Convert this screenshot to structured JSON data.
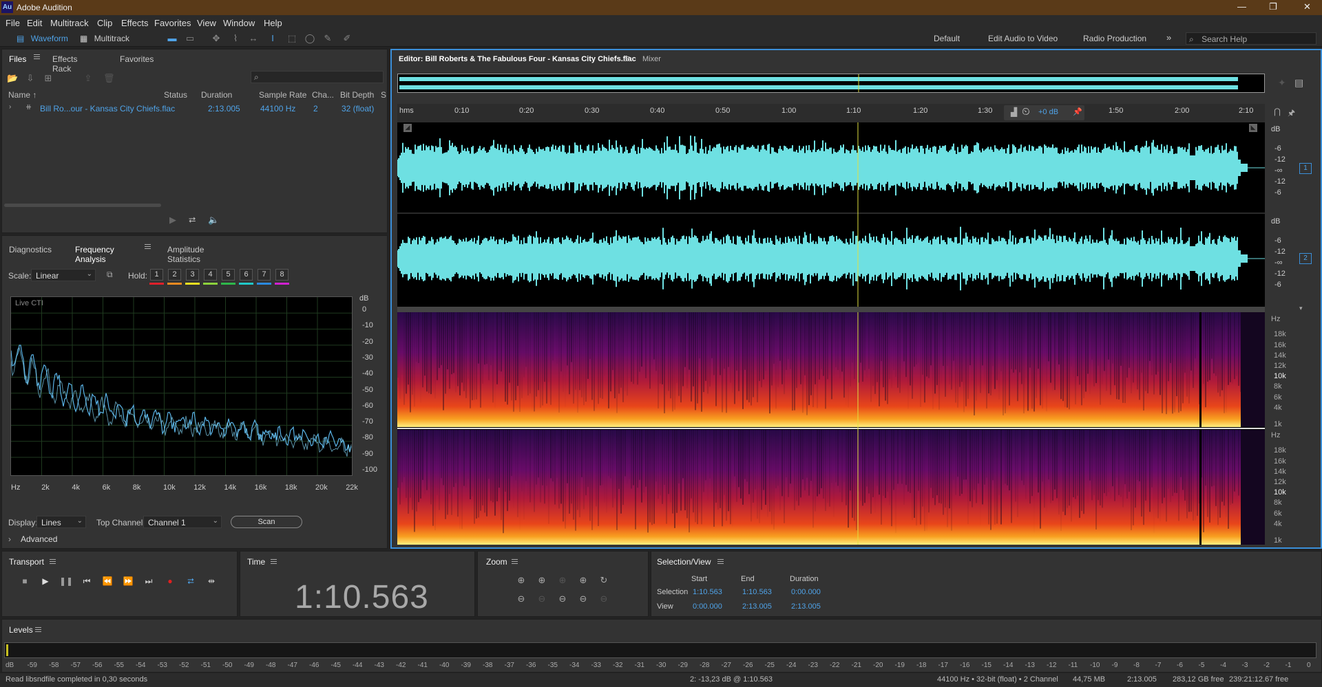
{
  "app": {
    "logo": "Au",
    "title": "Adobe Audition"
  },
  "menu": [
    "File",
    "Edit",
    "Multitrack",
    "Clip",
    "Effects",
    "Favorites",
    "View",
    "Window",
    "Help"
  ],
  "toolbar": {
    "waveform_label": "Waveform",
    "multitrack_label": "Multitrack",
    "workspaces": [
      "Default",
      "Edit Audio to Video",
      "Radio Production"
    ],
    "more": "»",
    "search_placeholder": "Search Help"
  },
  "files_panel": {
    "tabs": [
      "Files",
      "Effects Rack",
      "Favorites"
    ],
    "search_icon": "⌕",
    "columns": [
      "Name ↑",
      "Status",
      "Duration",
      "Sample Rate",
      "Cha...",
      "Bit Depth",
      "S"
    ],
    "file": {
      "name": "Bill Ro...our - Kansas City Chiefs.flac",
      "status": "",
      "duration": "2:13.005",
      "sample_rate": "44100 Hz",
      "channels": "2",
      "bit_depth": "32 (float)"
    }
  },
  "analysis_panel": {
    "tabs": [
      "Diagnostics",
      "Frequency Analysis",
      "Amplitude Statistics"
    ],
    "scale_label": "Scale:",
    "scale_value": "Linear",
    "hold_label": "Hold:",
    "hold_buttons": [
      "1",
      "2",
      "3",
      "4",
      "5",
      "6",
      "7",
      "8"
    ],
    "hold_colors": [
      "#e0202a",
      "#f08a20",
      "#f0e020",
      "#8cd23c",
      "#2eb84a",
      "#20c8c8",
      "#2a8ae0",
      "#d020d0"
    ],
    "graph_label": "Live CTI",
    "db_unit": "dB",
    "db_ticks": [
      "0",
      "-10",
      "-20",
      "-30",
      "-40",
      "-50",
      "-60",
      "-70",
      "-80",
      "-90",
      "-100"
    ],
    "hz_ticks": [
      "Hz",
      "2k",
      "4k",
      "6k",
      "8k",
      "10k",
      "12k",
      "14k",
      "16k",
      "18k",
      "20k",
      "22k"
    ],
    "display_label": "Display:",
    "display_value": "Lines",
    "top_channel_label": "Top Channel:",
    "top_channel_value": "Channel 1",
    "scan_label": "Scan",
    "advanced_label": "Advanced"
  },
  "editor": {
    "tab_title": "Editor: Bill Roberts & The Fabulous Four - Kansas City Chiefs.flac",
    "mixer_tab": "Mixer",
    "time_ticks": [
      "hms",
      "0:10",
      "0:20",
      "0:30",
      "0:40",
      "0:50",
      "1:00",
      "1:10",
      "1:20",
      "1:30",
      "1:50",
      "2:00",
      "2:10"
    ],
    "hud_gain": "+0 dB",
    "db_ticks_ch": [
      "dB",
      "-6",
      "-12",
      "-∞",
      "-12",
      "-6"
    ],
    "hz_ticks": [
      "Hz",
      "18k",
      "16k",
      "14k",
      "12k",
      "10k",
      "8k",
      "6k",
      "4k",
      "1k"
    ],
    "channel_badges": [
      "1",
      "2"
    ],
    "waveform_color": "#6ee0e2",
    "playhead_color": "#e0e040"
  },
  "transport": {
    "title": "Transport"
  },
  "time_panel": {
    "title": "Time",
    "value": "1:10.563"
  },
  "zoom_panel": {
    "title": "Zoom"
  },
  "selection_view": {
    "title": "Selection/View",
    "headers": [
      "Start",
      "End",
      "Duration"
    ],
    "rows": [
      {
        "label": "Selection",
        "start": "1:10.563",
        "end": "1:10.563",
        "duration": "0:00.000"
      },
      {
        "label": "View",
        "start": "0:00.000",
        "end": "2:13.005",
        "duration": "2:13.005"
      }
    ]
  },
  "levels": {
    "title": "Levels",
    "ticks": [
      "dB",
      "-59",
      "-58",
      "-57",
      "-56",
      "-55",
      "-54",
      "-53",
      "-52",
      "-51",
      "-50",
      "-49",
      "-48",
      "-47",
      "-46",
      "-45",
      "-44",
      "-43",
      "-42",
      "-41",
      "-40",
      "-39",
      "-38",
      "-37",
      "-36",
      "-35",
      "-34",
      "-33",
      "-32",
      "-31",
      "-30",
      "-29",
      "-28",
      "-27",
      "-26",
      "-25",
      "-24",
      "-23",
      "-22",
      "-21",
      "-20",
      "-19",
      "-18",
      "-17",
      "-16",
      "-15",
      "-14",
      "-13",
      "-12",
      "-11",
      "-10",
      "-9",
      "-8",
      "-7",
      "-6",
      "-5",
      "-4",
      "-3",
      "-2",
      "-1",
      "0"
    ]
  },
  "status": {
    "message": "Read libsndfile completed in 0,30 seconds",
    "cursor_info": "2: -13,23 dB @ 1:10.563",
    "format": "44100 Hz • 32-bit (float) • 2 Channel",
    "size": "44,75 MB",
    "duration": "2:13.005",
    "free_space": "283,12 GB free",
    "free_time": "239:21:12.67 free"
  }
}
